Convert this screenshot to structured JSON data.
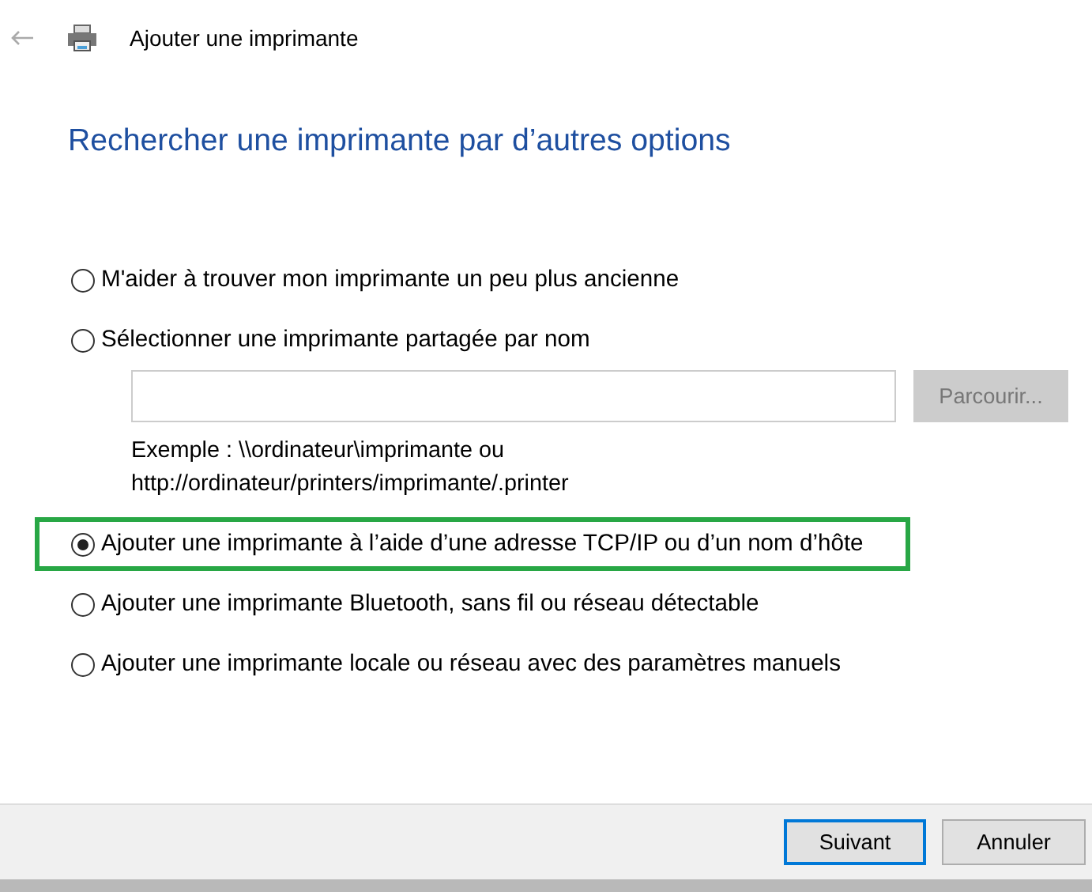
{
  "window": {
    "title": "Ajouter une imprimante"
  },
  "heading": "Rechercher une imprimante par d’autres options",
  "options": [
    {
      "kind": "plain",
      "label": "M'aider à trouver mon imprimante un peu plus ancienne",
      "selected": false,
      "highlighted": false
    },
    {
      "kind": "shared",
      "label": "Sélectionner une imprimante partagée par nom",
      "selected": false,
      "highlighted": false,
      "browse": "Parcourir...",
      "example": [
        "Exemple : \\\\ordinateur\\imprimante ou",
        "http://ordinateur/printers/imprimante/.printer"
      ]
    },
    {
      "kind": "plain",
      "label": "Ajouter une imprimante à l’aide d’une adresse TCP/IP ou d’un nom d’hôte",
      "selected": true,
      "highlighted": true
    },
    {
      "kind": "plain",
      "label": "Ajouter une imprimante Bluetooth, sans fil ou réseau détectable",
      "selected": false,
      "highlighted": false
    },
    {
      "kind": "plain",
      "label": "Ajouter une imprimante locale ou réseau avec des paramètres manuels",
      "selected": false,
      "highlighted": false
    }
  ],
  "buttons": [
    {
      "label": "Suivant",
      "default": true
    },
    {
      "label": "Annuler",
      "default": false
    }
  ]
}
